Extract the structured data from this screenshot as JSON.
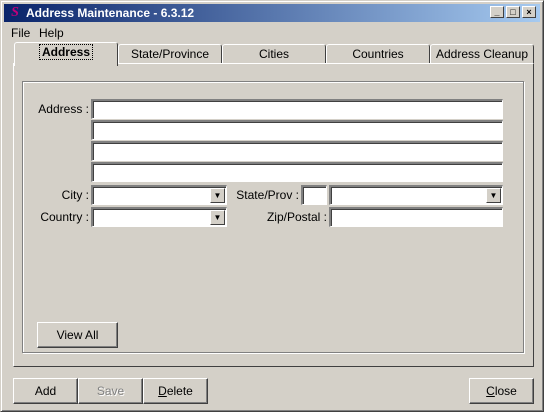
{
  "window": {
    "title": "Address Maintenance - 6.3.12",
    "icon": "app-logo-icon"
  },
  "titlebar_buttons": {
    "minimize": "_",
    "maximize": "□",
    "close": "×"
  },
  "menu": [
    "File",
    "Help"
  ],
  "tabs": [
    {
      "label": "Address",
      "active": true
    },
    {
      "label": "State/Province",
      "active": false
    },
    {
      "label": "Cities",
      "active": false
    },
    {
      "label": "Countries",
      "active": false
    },
    {
      "label": "Address Cleanup",
      "active": false
    }
  ],
  "form": {
    "address_label": "Address :",
    "address_lines": [
      "",
      "",
      "",
      ""
    ],
    "city_label": "City :",
    "city_value": "",
    "state_label": "State/Prov :",
    "state_code": "",
    "state_value": "",
    "country_label": "Country :",
    "country_value": "",
    "zip_label": "Zip/Postal :",
    "zip_value": ""
  },
  "view_all_label": "View All",
  "footer": {
    "add": "Add",
    "save": "Save",
    "delete_rest": "elete",
    "delete_accel": "D",
    "close_accel": "C",
    "close_rest": "lose"
  }
}
